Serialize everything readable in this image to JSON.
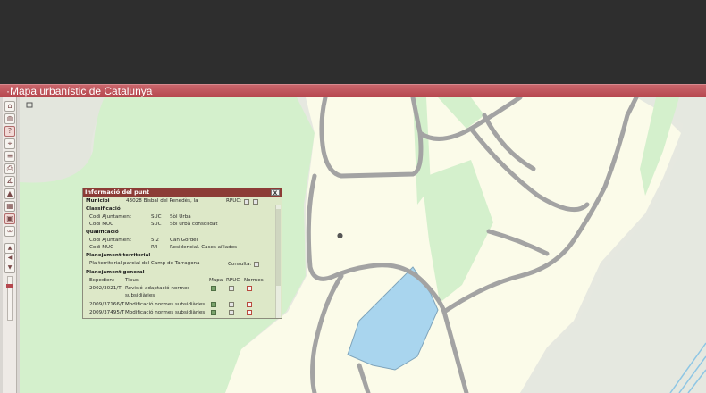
{
  "app": {
    "title": "·Mapa urbanístic de Catalunya"
  },
  "toolbar": {
    "tools": [
      {
        "name": "home-tool",
        "glyph": "⌂"
      },
      {
        "name": "globe-tool",
        "glyph": "◍"
      },
      {
        "name": "info-tool",
        "glyph": "?"
      },
      {
        "name": "measure-tool",
        "glyph": "⌖"
      },
      {
        "name": "layers-tool",
        "glyph": "≡"
      },
      {
        "name": "print-tool",
        "glyph": "⎙"
      },
      {
        "name": "chart-tool",
        "glyph": "∡"
      },
      {
        "name": "area-tool",
        "glyph": "▲"
      },
      {
        "name": "grid-tool",
        "glyph": "▦"
      },
      {
        "name": "select-tool",
        "glyph": "▣"
      },
      {
        "name": "link-tool",
        "glyph": "∞"
      }
    ],
    "pan": {
      "up": "▲",
      "left": "◀",
      "right": "▶",
      "down": "▼"
    },
    "zoom": {
      "plus": "+",
      "minus": "−"
    }
  },
  "popup": {
    "title": "Informació del punt",
    "close": "X",
    "municipi_label": "Municipi",
    "municipi_value": "43028 Bisbal del Penedès, la",
    "rpuc_label": "RPUC:",
    "classificacio": {
      "heading": "Classificació",
      "rows": [
        {
          "label": "Codi Ajuntament",
          "code": "SUC",
          "desc": "Sòl Urbà"
        },
        {
          "label": "Codi MUC",
          "code": "SUC",
          "desc": "Sòl urbà consolidat"
        }
      ]
    },
    "qualificacio": {
      "heading": "Qualificació",
      "rows": [
        {
          "label": "Codi Ajuntament",
          "code": "5.2",
          "desc": "Can Gordei"
        },
        {
          "label": "Codi MUC",
          "code": "R4",
          "desc": "Residencial. Cases aïllades"
        }
      ]
    },
    "territorial": {
      "heading": "Planejament territorial",
      "plan": "Pla territorial parcial del Camp de Tarragona",
      "consulta_label": "Consulta:"
    },
    "general": {
      "heading": "Planejament general",
      "columns": [
        "Expedient",
        "Tipus",
        "Mapa",
        "RPUC",
        "Normes"
      ],
      "rows": [
        {
          "expedient": "2002/3021/T",
          "tipus": "Revisió-adaptació normes",
          "tipus2": "subsidiàries"
        },
        {
          "expedient": "2009/37166/T",
          "tipus": "Modificació normes subsidiàries",
          "tipus2": ""
        },
        {
          "expedient": "2009/37495/T",
          "tipus": "Modificació normes subsidiàries",
          "tipus2": ""
        }
      ]
    }
  },
  "colors": {
    "titlebar": "#b6474e",
    "cream": "#fbfbe9",
    "green": "#d4f0cc",
    "water": "#a9d5ee",
    "road": "#a3a3a3",
    "grey": "#e6e8e0"
  }
}
